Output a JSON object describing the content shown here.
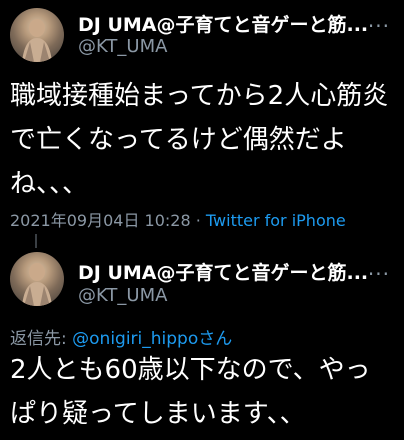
{
  "tweet1": {
    "name": "DJ UMA@子育てと音ゲーと筋...",
    "handle": "@KT_UMA",
    "more": "...",
    "text": "職域接種始まってから2人心筋炎で亡くなってるけど偶然だよね、、、",
    "timestamp": "2021年09月04日 10:28",
    "separator": " · ",
    "client": "Twitter for iPhone"
  },
  "tweet2": {
    "name": "DJ UMA@子育てと音ゲーと筋...",
    "handle": "@KT_UMA",
    "more": "...",
    "reply_prefix": "返信先: ",
    "reply_to": "@onigiri_hippoさん",
    "text": "2人とも60歳以下なので、やっぱり疑ってしまいます、、"
  },
  "colors": {
    "background": "#000000",
    "text": "#ffffff",
    "secondary": "#8b98a5",
    "link": "#1d9bf0"
  },
  "icons": [
    "avatar",
    "more-icon"
  ]
}
